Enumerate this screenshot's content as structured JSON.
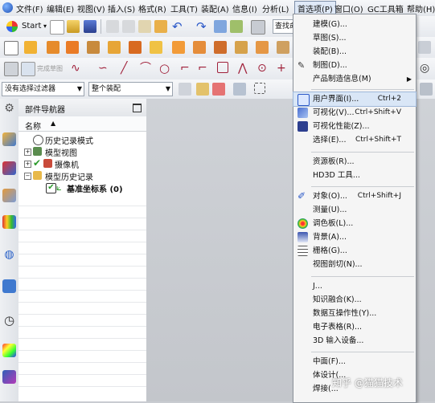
{
  "menubar": {
    "items": [
      "文件(F)",
      "编辑(E)",
      "视图(V)",
      "插入(S)",
      "格式(R)",
      "工具(T)",
      "装配(A)",
      "信息(I)",
      "分析(L)",
      "首选项(P)",
      "窗口(O)",
      "GC工具箱",
      "帮助(H)"
    ]
  },
  "toolbar": {
    "start_label": "Start",
    "find_placeholder": "查找命",
    "create_sketch_label": "完成草图",
    "filter_select": "没有选择过滤器",
    "assembly_select": "整个装配"
  },
  "navigator": {
    "title": "部件导航器",
    "column_name": "名称",
    "rows": [
      {
        "label": "历史记录模式"
      },
      {
        "label": "模型视图"
      },
      {
        "label": "摄像机"
      },
      {
        "label": "模型历史记录"
      },
      {
        "label": "基准坐标系 (0)"
      }
    ]
  },
  "preferences_menu": {
    "items": [
      {
        "label": "建模(G)...",
        "shortcut": ""
      },
      {
        "label": "草图(S)...",
        "shortcut": ""
      },
      {
        "label": "装配(B)...",
        "shortcut": ""
      },
      {
        "label": "制图(D)...",
        "shortcut": ""
      },
      {
        "label": "产品制造信息(M)",
        "shortcut": "",
        "submenu": "▶"
      },
      {
        "label": "用户界面(I)...",
        "shortcut": "Ctrl+2"
      },
      {
        "label": "可视化(V)...",
        "shortcut": "Ctrl+Shift+V"
      },
      {
        "label": "可视化性能(Z)...",
        "shortcut": ""
      },
      {
        "label": "选择(E)...",
        "shortcut": "Ctrl+Shift+T"
      },
      {
        "label": "资源板(R)...",
        "shortcut": ""
      },
      {
        "label": "HD3D 工具...",
        "shortcut": ""
      },
      {
        "label": "对象(O)...",
        "shortcut": "Ctrl+Shift+J"
      },
      {
        "label": "调色板(L)...",
        "shortcut": ""
      },
      {
        "label": "背景(A)...",
        "shortcut": ""
      },
      {
        "label": "栅格(G)...",
        "shortcut": ""
      },
      {
        "label": "视图剖切(N)...",
        "shortcut": ""
      },
      {
        "label": "J...",
        "shortcut": ""
      },
      {
        "label": "知识融合(K)...",
        "shortcut": ""
      },
      {
        "label": "数据互操作性(Y)...",
        "shortcut": ""
      },
      {
        "label": "电子表格(R)...",
        "shortcut": ""
      },
      {
        "label": "3D 输入设备...",
        "shortcut": ""
      },
      {
        "label": "中面(F)...",
        "shortcut": ""
      },
      {
        "label": "体设计(...",
        "shortcut": ""
      },
      {
        "label": "焊接(...",
        "shortcut": ""
      }
    ],
    "measure_label": "测量(U)..."
  },
  "watermark": "知乎 @猫猫技术",
  "colors": {
    "highlight": "#d9e6f6",
    "menu_bg": "#f5f5f5",
    "canvas": "#c8cbd0"
  }
}
